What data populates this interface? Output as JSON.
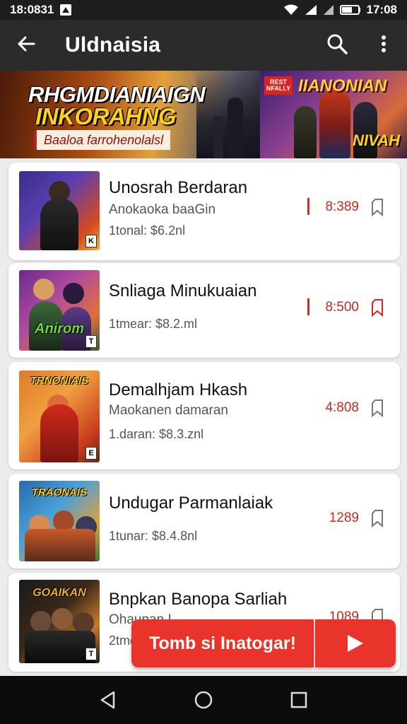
{
  "status_bar": {
    "time_left": "18:0831",
    "time_right": "17:08"
  },
  "app_bar": {
    "title": "Uldnaisia"
  },
  "banner": {
    "title_line1": "RHGMDIANIAIGN",
    "title_line2": "INKORAHNG",
    "subtitle": "Baaloa farrohenolalsl",
    "side_title": "IIANONIAN",
    "side_tag": "NIVAH",
    "side_badge": "REST NFALLY"
  },
  "items": [
    {
      "title": "Unosrah Berdaran",
      "subtitle": "Anokaoka baaGin",
      "meta": "1tonal: $6.2nl",
      "price": "8:389"
    },
    {
      "title": "Snliaga Minukuaian",
      "subtitle": "",
      "meta": "1tmear: $8.2.ml",
      "price": "8:500"
    },
    {
      "title": "Demalhjam Hkash",
      "subtitle": "Maokanen damaran",
      "meta": "1.daran: $8.3.znl",
      "price": "4:808"
    },
    {
      "title": "Undugar Parmanlaiak",
      "subtitle": "",
      "meta": "1tunar: $8.4.8nl",
      "price": "1289"
    },
    {
      "title": "Bnpkan Banopa Sarliah",
      "subtitle": "Ohaunan I",
      "meta": "2tmen",
      "price": "1089"
    }
  ],
  "thumb_labels": [
    "",
    "Anirom",
    "TRNONIAIS",
    "TRAONAIS",
    "GOAIKAN"
  ],
  "thumb_ratings": [
    "K",
    "T",
    "E",
    "",
    "T"
  ],
  "fab": {
    "label": "Tomb si Inatogar!"
  },
  "colors": {
    "accent": "#e8342a",
    "price": "#c22a22",
    "app_bar": "#2b2b2b"
  },
  "icons": [
    "back-arrow-icon",
    "search-icon",
    "more-vert-icon",
    "bookmark-icon",
    "play-icon",
    "nav-back-icon",
    "nav-home-icon",
    "nav-recents-icon"
  ]
}
